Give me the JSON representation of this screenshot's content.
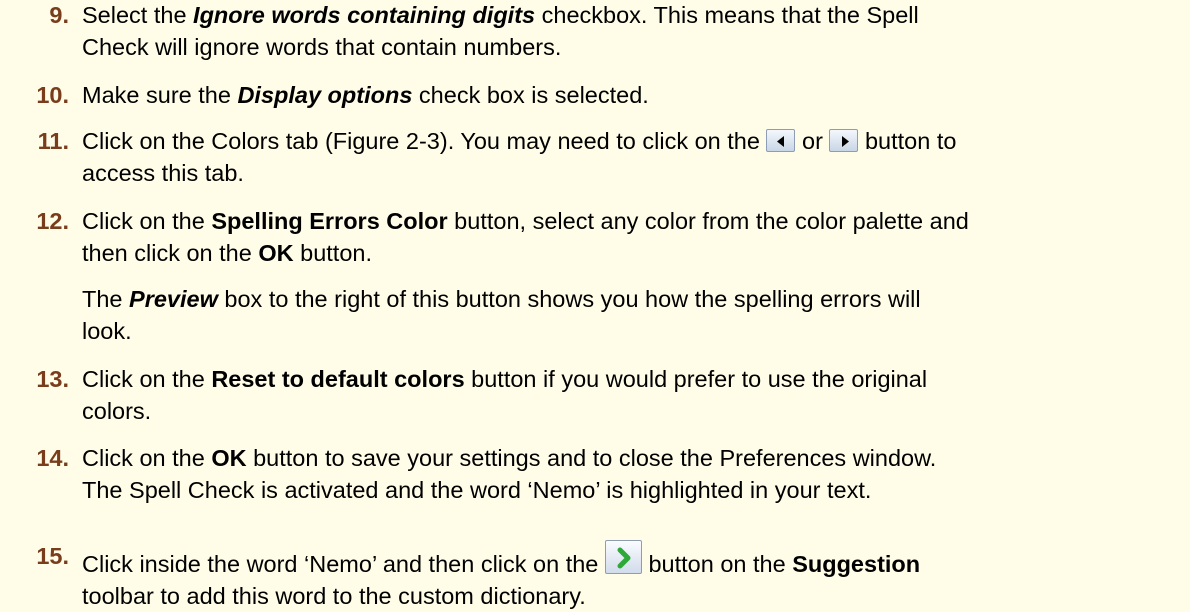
{
  "steps": [
    {
      "num": "9.",
      "lines": [
        "Select the ",
        "Ignore words containing digits",
        " checkbox. This means that the Spell",
        "Check will ignore words that contain numbers."
      ]
    },
    {
      "num": "10.",
      "parts": [
        "Make sure the ",
        "Display options",
        " check box is selected."
      ]
    },
    {
      "num": "11.",
      "parts": [
        "Click on the Colors tab (Figure 2-3). You may need to click on the ",
        " or ",
        " button to",
        "access this tab."
      ]
    },
    {
      "num": "12.",
      "parts": [
        "Click on the ",
        "Spelling Errors Color",
        " button, select any color from the color palette and",
        "then click on the ",
        "OK",
        " button."
      ]
    },
    {
      "num": "13.",
      "parts": [
        "Click on the ",
        "Reset to default colors",
        " button if you would prefer to use the original",
        "colors."
      ]
    },
    {
      "num": "14.",
      "parts": [
        "Click on the ",
        "OK",
        " button to save your settings and to close the Preferences window."
      ]
    },
    {
      "num": "15.",
      "parts": [
        "Click inside the word ‘Nemo’ and then click on the ",
        " button on the ",
        "Suggestion",
        "toolbar to add this word to the custom dictionary."
      ]
    }
  ],
  "notes": {
    "preview": [
      "The ",
      "Preview",
      " box to the right of this button shows you how the spelling errors will",
      "look."
    ],
    "activated": "The Spell Check is activated and the word ‘Nemo’ is highlighted in your text."
  },
  "icons": {
    "scroll_left": "scroll-left-icon",
    "scroll_right": "scroll-right-icon",
    "add_to_dictionary": "add-to-dictionary-icon"
  },
  "colors": {
    "step_number": "#7a3d1c",
    "background": "#fffde8",
    "suggestion_arrow": "#2fa83a"
  }
}
